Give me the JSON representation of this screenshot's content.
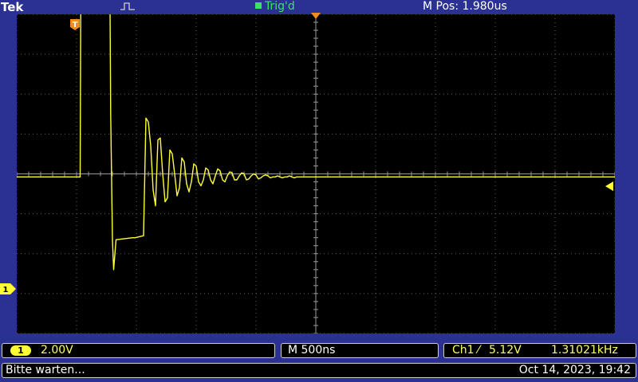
{
  "header": {
    "brand": "Tek",
    "acquire_icon": "pulse-icon",
    "trigger_status": "Trig'd",
    "horizontal_position": "M Pos: 1.980us"
  },
  "colors": {
    "background": "#2b3192",
    "screen": "#000000",
    "trace": "#ffff33",
    "graticule": "#606060",
    "trigger_status": "#3ee06a",
    "marker_orange": "#f08c1e"
  },
  "markers": {
    "trigger_position": "T",
    "channel_ground": "1"
  },
  "channel1": {
    "badge": "1",
    "volts_per_div": "2.00V"
  },
  "timebase": {
    "label": "M 500ns"
  },
  "trigger": {
    "source": "Ch1",
    "slope": "⁄",
    "level": "5.12V",
    "frequency": "1.31021kHz"
  },
  "status": {
    "message": "Bitte warten...",
    "datetime": "Oct 14, 2023, 19:42"
  },
  "chart_data": {
    "type": "line",
    "title": "",
    "xlabel": "",
    "ylabel": "",
    "x_unit": "ns",
    "y_unit": "V",
    "xlim": [
      -2500,
      2500
    ],
    "ylim": [
      -8,
      8
    ],
    "grid": true,
    "divisions": {
      "horizontal": 10,
      "vertical": 8
    },
    "series": [
      {
        "x": [
          -2500,
          -1970,
          -1965,
          -1945,
          -1720,
          -1715,
          -1700,
          -1690,
          -1670,
          -1530,
          -1510,
          -1440,
          -1420,
          -1400,
          -1380,
          -1360,
          -1340,
          -1320,
          -1300,
          -1280,
          -1260,
          -1240,
          -1220,
          -1200,
          -1180,
          -1160,
          -1140,
          -1120,
          -1100,
          -1080,
          -1060,
          -1040,
          -1020,
          -1000,
          -980,
          -960,
          -940,
          -920,
          -900,
          -880,
          -860,
          -840,
          -820,
          -800,
          -780,
          -760,
          -740,
          -720,
          -700,
          -680,
          -660,
          -640,
          -620,
          -600,
          -580,
          -560,
          -540,
          -520,
          -500,
          -480,
          -460,
          -440,
          -420,
          -400,
          -380,
          -360,
          -340,
          -320,
          -300,
          -280,
          -260,
          -240,
          -220,
          -200,
          -180,
          -160,
          -140,
          -120,
          -100,
          -80,
          -60,
          -40,
          -20,
          0,
          2500
        ],
        "y": [
          -0.15,
          -0.15,
          8.6,
          8.3,
          8.2,
          3.0,
          -3.3,
          -4.8,
          -3.3,
          -3.2,
          -3.2,
          -3.1,
          2.8,
          2.6,
          1.4,
          -0.8,
          -1.6,
          1.7,
          1.8,
          0.0,
          -1.4,
          -1.2,
          1.2,
          1.0,
          0.0,
          -1.1,
          -0.7,
          0.8,
          0.6,
          -0.5,
          -0.9,
          -0.4,
          0.5,
          0.4,
          -0.4,
          -0.6,
          -0.3,
          0.3,
          0.2,
          -0.3,
          -0.5,
          -0.1,
          0.25,
          0.15,
          -0.3,
          -0.4,
          -0.1,
          0.1,
          0.05,
          -0.3,
          -0.3,
          -0.1,
          0.05,
          0.0,
          -0.3,
          -0.25,
          -0.1,
          0.0,
          -0.05,
          -0.25,
          -0.2,
          -0.1,
          -0.05,
          -0.1,
          -0.2,
          -0.15,
          -0.15,
          -0.1,
          -0.15,
          -0.2,
          -0.15,
          -0.15,
          -0.1,
          -0.15,
          -0.2,
          -0.15,
          -0.15,
          -0.15,
          -0.15,
          -0.15,
          -0.15,
          -0.15,
          -0.15,
          -0.15,
          -0.15
        ]
      }
    ]
  }
}
